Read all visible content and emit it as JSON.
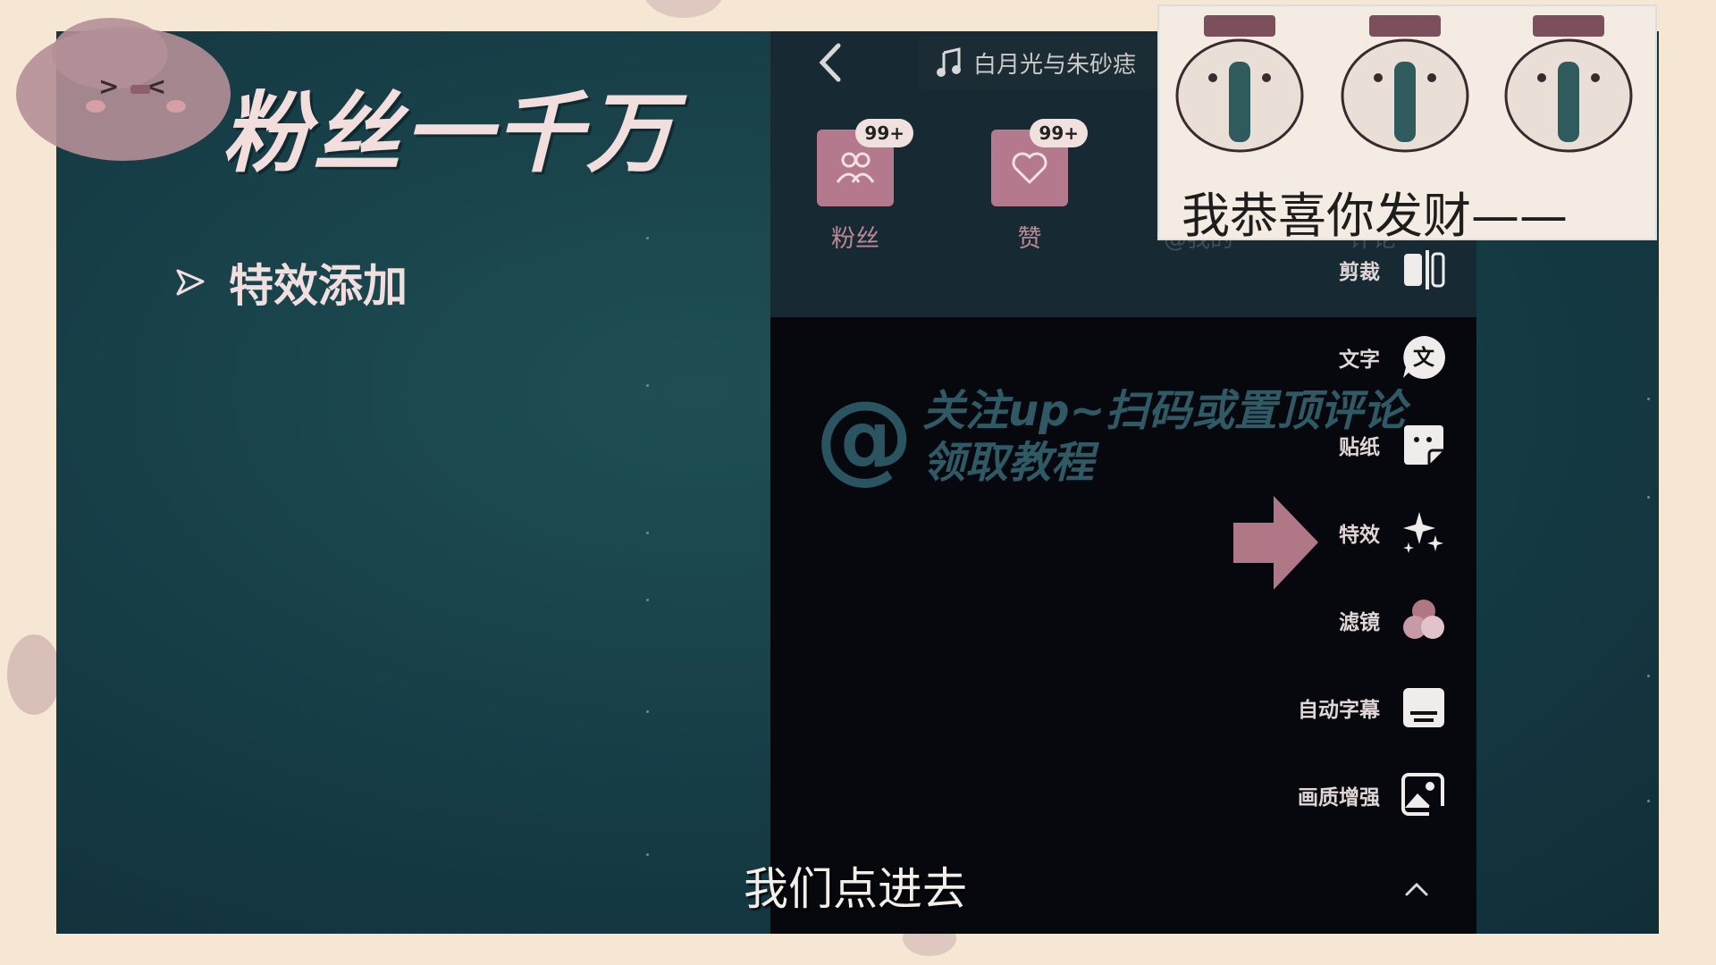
{
  "slide": {
    "title": "粉丝一千万",
    "bullet": "特效添加"
  },
  "phone": {
    "music_title": "白月光与朱砂痣",
    "notifications": [
      {
        "label": "粉丝",
        "badge": "99+"
      },
      {
        "label": "赞",
        "badge": "99+"
      }
    ],
    "hidden_labels": [
      "@我的",
      "评论"
    ],
    "menu": [
      {
        "label": "剪裁",
        "icon": "trim-icon"
      },
      {
        "label": "文字",
        "icon": "text-icon"
      },
      {
        "label": "贴纸",
        "icon": "sticker-icon"
      },
      {
        "label": "特效",
        "icon": "sparkle-effects-icon"
      },
      {
        "label": "滤镜",
        "icon": "filter-circles-icon"
      },
      {
        "label": "自动字幕",
        "icon": "auto-caption-icon"
      },
      {
        "label": "画质增强",
        "icon": "quality-enhance-icon"
      }
    ],
    "watermark_line1": "关注up~扫码或置顶评论",
    "watermark_line2": "领取教程",
    "subtitle": "我们点进去"
  },
  "overlay": {
    "caption": "我恭喜你发财——"
  },
  "colors": {
    "accent": "#b4798c",
    "frame": "#153a44",
    "page_bg": "#f6e7d4"
  }
}
